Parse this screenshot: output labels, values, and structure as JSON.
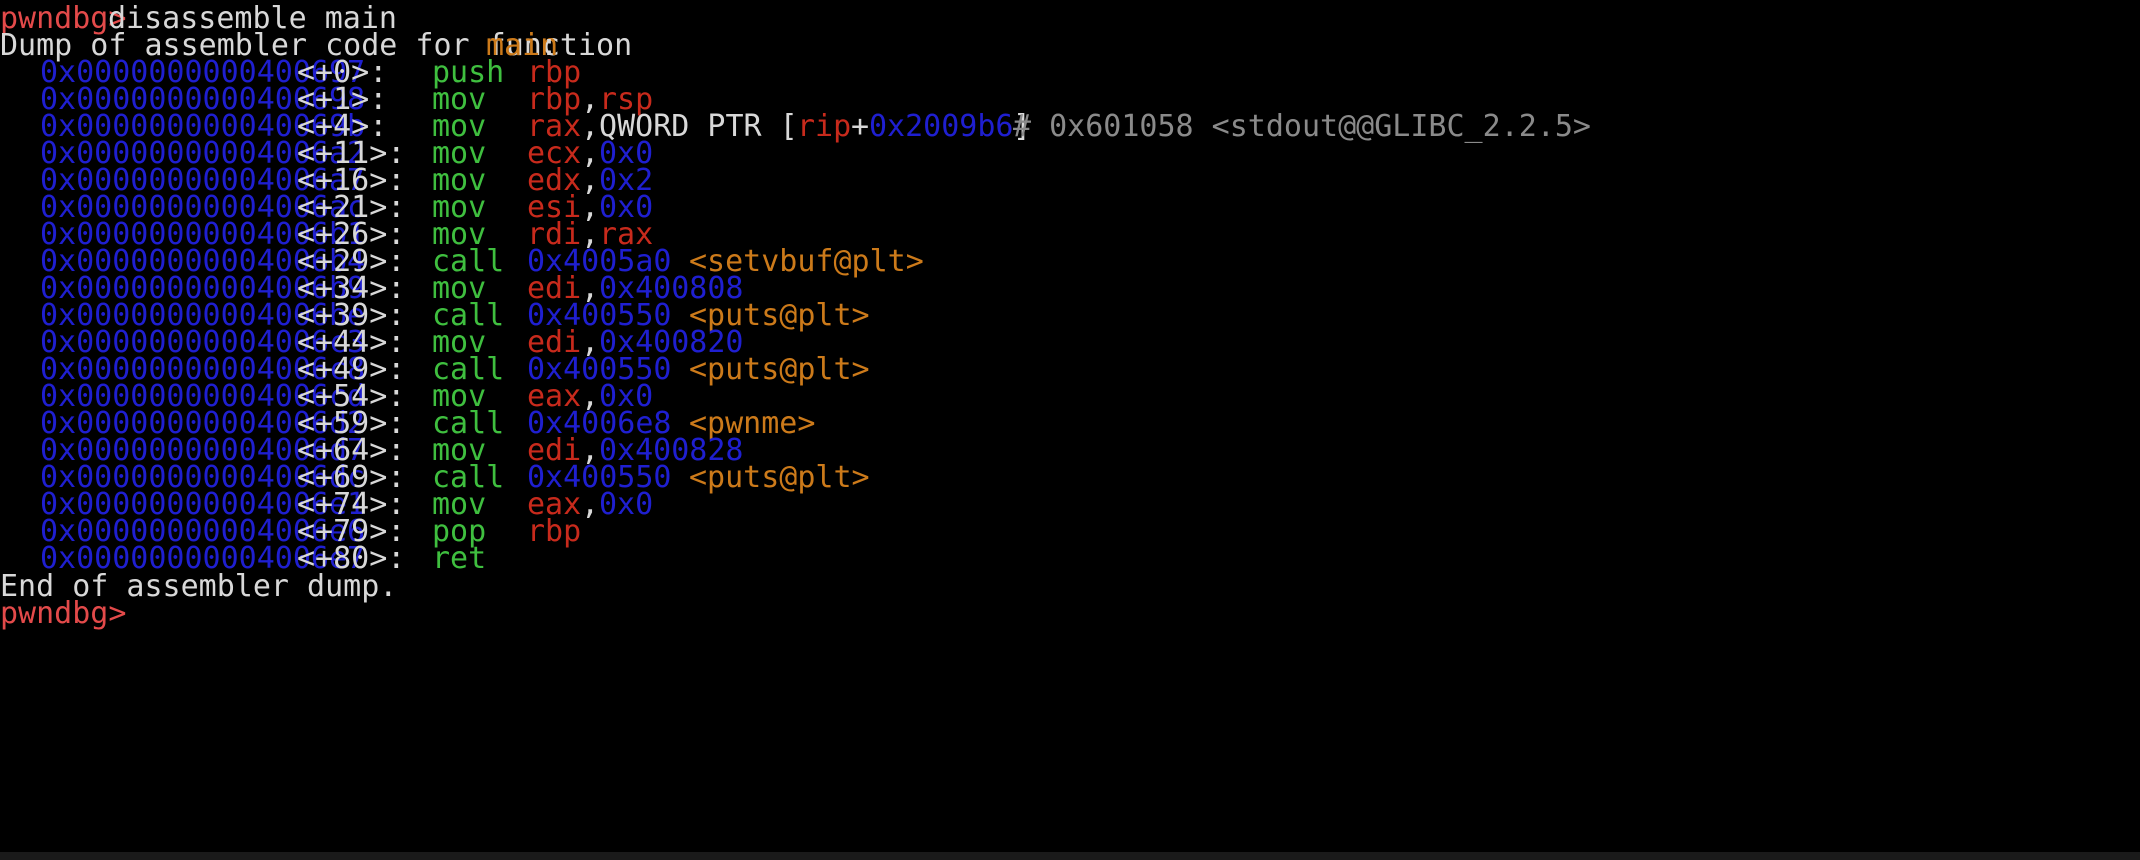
{
  "prompt": "pwndbg>",
  "command": "disassemble main",
  "dump_header": {
    "text": "Dump of assembler code for function ",
    "function": "main",
    "suffix": ":"
  },
  "instructions": [
    {
      "address": "0x0000000000400697",
      "offset": "<+0>:",
      "mnemonic": "push",
      "operand_parts": [
        [
          "rbp",
          "reg"
        ]
      ]
    },
    {
      "address": "0x0000000000400698",
      "offset": "<+1>:",
      "mnemonic": "mov",
      "operand_parts": [
        [
          "rbp",
          "reg"
        ],
        [
          ",",
          "punct"
        ],
        [
          "rsp",
          "reg"
        ]
      ]
    },
    {
      "address": "0x000000000040069b",
      "offset": "<+4>:",
      "mnemonic": "mov",
      "operand_parts": [
        [
          "rax",
          "reg"
        ],
        [
          ",QWORD PTR [",
          "punct"
        ],
        [
          "rip",
          "reg"
        ],
        [
          "+",
          "punct"
        ],
        [
          "0x2009b6",
          "imm"
        ],
        [
          "]",
          "punct"
        ]
      ],
      "comment": "# 0x601058 <stdout@@GLIBC_2.2.5>"
    },
    {
      "address": "0x00000000004006a2",
      "offset": "<+11>:",
      "mnemonic": "mov",
      "operand_parts": [
        [
          "ecx",
          "reg"
        ],
        [
          ",",
          "punct"
        ],
        [
          "0x0",
          "imm"
        ]
      ]
    },
    {
      "address": "0x00000000004006a7",
      "offset": "<+16>:",
      "mnemonic": "mov",
      "operand_parts": [
        [
          "edx",
          "reg"
        ],
        [
          ",",
          "punct"
        ],
        [
          "0x2",
          "imm"
        ]
      ]
    },
    {
      "address": "0x00000000004006ac",
      "offset": "<+21>:",
      "mnemonic": "mov",
      "operand_parts": [
        [
          "esi",
          "reg"
        ],
        [
          ",",
          "punct"
        ],
        [
          "0x0",
          "imm"
        ]
      ]
    },
    {
      "address": "0x00000000004006b1",
      "offset": "<+26>:",
      "mnemonic": "mov",
      "operand_parts": [
        [
          "rdi",
          "reg"
        ],
        [
          ",",
          "punct"
        ],
        [
          "rax",
          "reg"
        ]
      ]
    },
    {
      "address": "0x00000000004006b4",
      "offset": "<+29>:",
      "mnemonic": "call",
      "operand_parts": [
        [
          "0x4005a0",
          "imm"
        ],
        [
          " ",
          "punct"
        ],
        [
          "<setvbuf@plt>",
          "sym"
        ]
      ]
    },
    {
      "address": "0x00000000004006b9",
      "offset": "<+34>:",
      "mnemonic": "mov",
      "operand_parts": [
        [
          "edi",
          "reg"
        ],
        [
          ",",
          "punct"
        ],
        [
          "0x400808",
          "imm"
        ]
      ]
    },
    {
      "address": "0x00000000004006be",
      "offset": "<+39>:",
      "mnemonic": "call",
      "operand_parts": [
        [
          "0x400550",
          "imm"
        ],
        [
          " ",
          "punct"
        ],
        [
          "<puts@plt>",
          "sym"
        ]
      ]
    },
    {
      "address": "0x00000000004006c3",
      "offset": "<+44>:",
      "mnemonic": "mov",
      "operand_parts": [
        [
          "edi",
          "reg"
        ],
        [
          ",",
          "punct"
        ],
        [
          "0x400820",
          "imm"
        ]
      ]
    },
    {
      "address": "0x00000000004006c8",
      "offset": "<+49>:",
      "mnemonic": "call",
      "operand_parts": [
        [
          "0x400550",
          "imm"
        ],
        [
          " ",
          "punct"
        ],
        [
          "<puts@plt>",
          "sym"
        ]
      ]
    },
    {
      "address": "0x00000000004006cd",
      "offset": "<+54>:",
      "mnemonic": "mov",
      "operand_parts": [
        [
          "eax",
          "reg"
        ],
        [
          ",",
          "punct"
        ],
        [
          "0x0",
          "imm"
        ]
      ]
    },
    {
      "address": "0x00000000004006d2",
      "offset": "<+59>:",
      "mnemonic": "call",
      "operand_parts": [
        [
          "0x4006e8",
          "imm"
        ],
        [
          " ",
          "punct"
        ],
        [
          "<pwnme>",
          "sym"
        ]
      ]
    },
    {
      "address": "0x00000000004006d7",
      "offset": "<+64>:",
      "mnemonic": "mov",
      "operand_parts": [
        [
          "edi",
          "reg"
        ],
        [
          ",",
          "punct"
        ],
        [
          "0x400828",
          "imm"
        ]
      ]
    },
    {
      "address": "0x00000000004006dc",
      "offset": "<+69>:",
      "mnemonic": "call",
      "operand_parts": [
        [
          "0x400550",
          "imm"
        ],
        [
          " ",
          "punct"
        ],
        [
          "<puts@plt>",
          "sym"
        ]
      ]
    },
    {
      "address": "0x00000000004006e1",
      "offset": "<+74>:",
      "mnemonic": "mov",
      "operand_parts": [
        [
          "eax",
          "reg"
        ],
        [
          ",",
          "punct"
        ],
        [
          "0x0",
          "imm"
        ]
      ]
    },
    {
      "address": "0x00000000004006e6",
      "offset": "<+79>:",
      "mnemonic": "pop",
      "operand_parts": [
        [
          "rbp",
          "reg"
        ]
      ]
    },
    {
      "address": "0x00000000004006e7",
      "offset": "<+80>:",
      "mnemonic": "ret",
      "operand_parts": []
    }
  ],
  "footer": "End of assembler dump.",
  "final_prompt": "pwndbg>",
  "colors": {
    "background": "#000000",
    "prompt": "#e34a4a",
    "text": "#d8d8d8",
    "address": "#1f1fd0",
    "mnemonic": "#3fbf3f",
    "register": "#c82a1c",
    "immediate": "#1f1fd0",
    "symbol": "#cc7a1a",
    "comment": "#8a8a8a"
  }
}
